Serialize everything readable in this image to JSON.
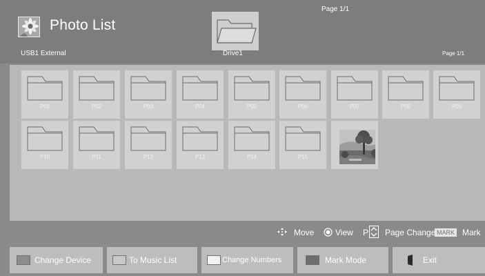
{
  "header": {
    "app_title": "Photo List",
    "page_indicator_top": "Page 1/1",
    "device_label": "USB1 External",
    "drive_label": "Drive1",
    "page_indicator_right": "Page 1/1"
  },
  "grid": {
    "folders": [
      "P01",
      "P02",
      "P03",
      "P04",
      "P05",
      "P06",
      "P07",
      "P08",
      "P09",
      "P10",
      "P11",
      "P12",
      "P13",
      "P14",
      "P15"
    ],
    "photo_icon": "landscape-photo-icon"
  },
  "hints": {
    "move": "Move",
    "view": "View",
    "page_change_prefix": "P",
    "page_change": "Page Change",
    "mark_key": "MARK",
    "mark": "Mark"
  },
  "buttons": {
    "change_device": "Change Device",
    "to_music_list": "To Music List",
    "change_numbers": "Change Numbers",
    "mark_mode": "Mark Mode",
    "exit": "Exit"
  },
  "colors": {
    "header_bg": "#7d7d7d",
    "grid_bg": "#b9b9b9",
    "tile_bg": "#d1d1d1",
    "button_bg": "#bdbdbd",
    "swatch_change_device": "#8c8c8c",
    "swatch_to_music_list": "#c8c8c8",
    "swatch_change_numbers": "#f2f2f2",
    "swatch_mark_mode": "#6e6e6e",
    "swatch_exit": "#2b2b2b"
  }
}
